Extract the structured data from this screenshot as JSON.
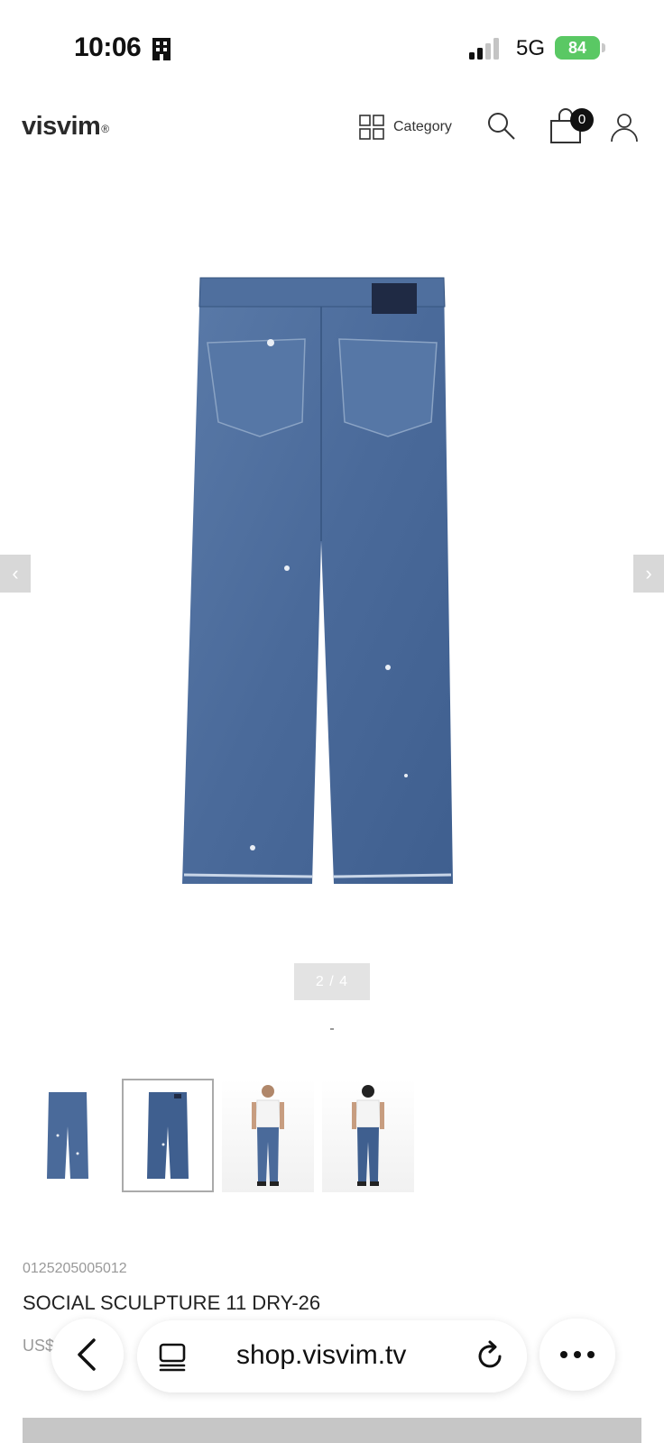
{
  "status_bar": {
    "time": "10:06",
    "network": "5G",
    "battery": "84"
  },
  "header": {
    "logo": "visvim",
    "logo_mark": "®",
    "category_label": "Category",
    "cart_count": "0"
  },
  "gallery": {
    "counter": "2 / 4",
    "prev_symbol": "‹",
    "next_symbol": "›",
    "selected_index": 2,
    "thumbnails": [
      {
        "name": "jeans-front"
      },
      {
        "name": "jeans-back"
      },
      {
        "name": "model-front"
      },
      {
        "name": "model-back"
      }
    ]
  },
  "product": {
    "code": "0125205005012",
    "name": "SOCIAL SCULPTURE 11 DRY-26",
    "price": "US$"
  },
  "browser": {
    "url": "shop.visvim.tv"
  },
  "colors": {
    "denim": "#4a6a9a",
    "battery": "#5ac864"
  }
}
